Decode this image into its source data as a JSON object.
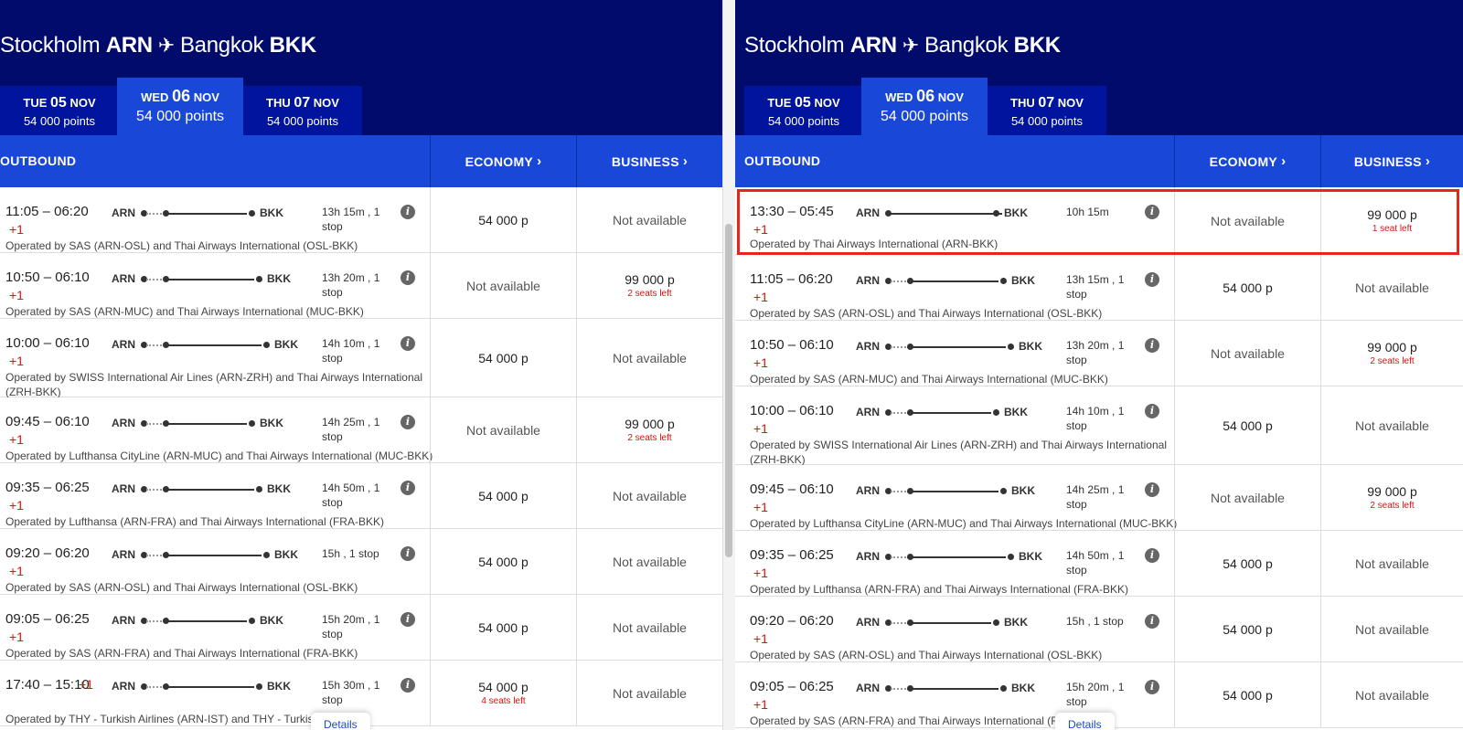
{
  "route": {
    "from_city": "Stockholm",
    "from_code": "ARN",
    "to_city": "Bangkok",
    "to_code": "BKK"
  },
  "tabs": [
    {
      "day": "TUE",
      "date": "05",
      "month": "NOV",
      "points": "54 000 points"
    },
    {
      "day": "WED",
      "date": "06",
      "month": "NOV",
      "points": "54 000 points"
    },
    {
      "day": "THU",
      "date": "07",
      "month": "NOV",
      "points": "54 000 points"
    }
  ],
  "active_tab": 1,
  "columns": {
    "outbound": "OUTBOUND",
    "economy": "ECONOMY",
    "business": "BUSINESS"
  },
  "colors": {
    "header_dark": "#000b6b",
    "accent_blue": "#1947d8",
    "alert_red": "#dd1111"
  },
  "left_flights": [
    {
      "dep": "11:05",
      "arr": "06:20",
      "plus": "+1",
      "dur": "13h 15m , 1",
      "dur2": "stop",
      "op": "Operated by SAS (ARN-OSL) and Thai Airways International (OSL-BKK)",
      "op2": "",
      "economy": "54 000 p",
      "economy_seats": "",
      "business": "Not available",
      "business_seats": ""
    },
    {
      "dep": "10:50",
      "arr": "06:10",
      "plus": "+1",
      "dur": "13h 20m , 1",
      "dur2": "stop",
      "op": "Operated by SAS (ARN-MUC) and Thai Airways International (MUC-BKK)",
      "op2": "",
      "economy": "Not available",
      "economy_seats": "",
      "business": "99 000 p",
      "business_seats": "2 seats left"
    },
    {
      "dep": "10:00",
      "arr": "06:10",
      "plus": "+1",
      "dur": "14h 10m , 1",
      "dur2": "stop",
      "op": "Operated by SWISS International Air Lines (ARN-ZRH) and Thai Airways International",
      "op2": "(ZRH-BKK)",
      "economy": "54 000 p",
      "economy_seats": "",
      "business": "Not available",
      "business_seats": ""
    },
    {
      "dep": "09:45",
      "arr": "06:10",
      "plus": "+1",
      "dur": "14h 25m , 1",
      "dur2": "stop",
      "op": "Operated by Lufthansa CityLine (ARN-MUC) and Thai Airways International (MUC-BKK)",
      "op2": "",
      "economy": "Not available",
      "economy_seats": "",
      "business": "99 000 p",
      "business_seats": "2 seats left"
    },
    {
      "dep": "09:35",
      "arr": "06:25",
      "plus": "+1",
      "dur": "14h 50m , 1",
      "dur2": "stop",
      "op": "Operated by Lufthansa (ARN-FRA) and Thai Airways International (FRA-BKK)",
      "op2": "",
      "economy": "54 000 p",
      "economy_seats": "",
      "business": "Not available",
      "business_seats": ""
    },
    {
      "dep": "09:20",
      "arr": "06:20",
      "plus": "+1",
      "dur": "15h , 1 stop",
      "dur2": "",
      "op": "Operated by SAS (ARN-OSL) and Thai Airways International (OSL-BKK)",
      "op2": "",
      "economy": "54 000 p",
      "economy_seats": "",
      "business": "Not available",
      "business_seats": ""
    },
    {
      "dep": "09:05",
      "arr": "06:25",
      "plus": "+1",
      "dur": "15h 20m , 1",
      "dur2": "stop",
      "op": "Operated by SAS (ARN-FRA) and Thai Airways International (FRA-BKK)",
      "op2": "",
      "economy": "54 000 p",
      "economy_seats": "",
      "business": "Not available",
      "business_seats": ""
    },
    {
      "dep": "17:40",
      "arr": "15:10",
      "plus": "+1",
      "dur": "15h 30m , 1",
      "dur2": "stop",
      "op": "Operated by THY - Turkish Airlines (ARN-IST) and THY - Turkish Air",
      "op2": "",
      "economy": "54 000 p",
      "economy_seats": "4 seats left",
      "business": "Not available",
      "business_seats": ""
    }
  ],
  "right_flights": [
    {
      "dep": "13:30",
      "arr": "05:45",
      "plus": "+1",
      "dur": "10h 15m",
      "dur2": "",
      "op": "Operated by Thai Airways International (ARN-BKK)",
      "op2": "",
      "economy": "Not available",
      "economy_seats": "",
      "business": "99 000 p",
      "business_seats": "1 seat left"
    },
    {
      "dep": "11:05",
      "arr": "06:20",
      "plus": "+1",
      "dur": "13h 15m , 1",
      "dur2": "stop",
      "op": "Operated by SAS (ARN-OSL) and Thai Airways International (OSL-BKK)",
      "op2": "",
      "economy": "54 000 p",
      "economy_seats": "",
      "business": "Not available",
      "business_seats": ""
    },
    {
      "dep": "10:50",
      "arr": "06:10",
      "plus": "+1",
      "dur": "13h 20m , 1",
      "dur2": "stop",
      "op": "Operated by SAS (ARN-MUC) and Thai Airways International (MUC-BKK)",
      "op2": "",
      "economy": "Not available",
      "economy_seats": "",
      "business": "99 000 p",
      "business_seats": "2 seats left"
    },
    {
      "dep": "10:00",
      "arr": "06:10",
      "plus": "+1",
      "dur": "14h 10m , 1",
      "dur2": "stop",
      "op": "Operated by SWISS International Air Lines (ARN-ZRH) and Thai Airways International",
      "op2": "(ZRH-BKK)",
      "economy": "54 000 p",
      "economy_seats": "",
      "business": "Not available",
      "business_seats": ""
    },
    {
      "dep": "09:45",
      "arr": "06:10",
      "plus": "+1",
      "dur": "14h 25m , 1",
      "dur2": "stop",
      "op": "Operated by Lufthansa CityLine (ARN-MUC) and Thai Airways International (MUC-BKK)",
      "op2": "",
      "economy": "Not available",
      "economy_seats": "",
      "business": "99 000 p",
      "business_seats": "2 seats left"
    },
    {
      "dep": "09:35",
      "arr": "06:25",
      "plus": "+1",
      "dur": "14h 50m , 1",
      "dur2": "stop",
      "op": "Operated by Lufthansa (ARN-FRA) and Thai Airways International (FRA-BKK)",
      "op2": "",
      "economy": "54 000 p",
      "economy_seats": "",
      "business": "Not available",
      "business_seats": ""
    },
    {
      "dep": "09:20",
      "arr": "06:20",
      "plus": "+1",
      "dur": "15h , 1 stop",
      "dur2": "",
      "op": "Operated by SAS (ARN-OSL) and Thai Airways International (OSL-BKK)",
      "op2": "",
      "economy": "54 000 p",
      "economy_seats": "",
      "business": "Not available",
      "business_seats": ""
    },
    {
      "dep": "09:05",
      "arr": "06:25",
      "plus": "+1",
      "dur": "15h 20m , 1",
      "dur2": "stop",
      "op": "Operated by SAS (ARN-FRA) and Thai Airways International (FRA-B",
      "op2": "",
      "economy": "54 000 p",
      "economy_seats": "",
      "business": "Not available",
      "business_seats": ""
    }
  ],
  "details_label": "Details"
}
